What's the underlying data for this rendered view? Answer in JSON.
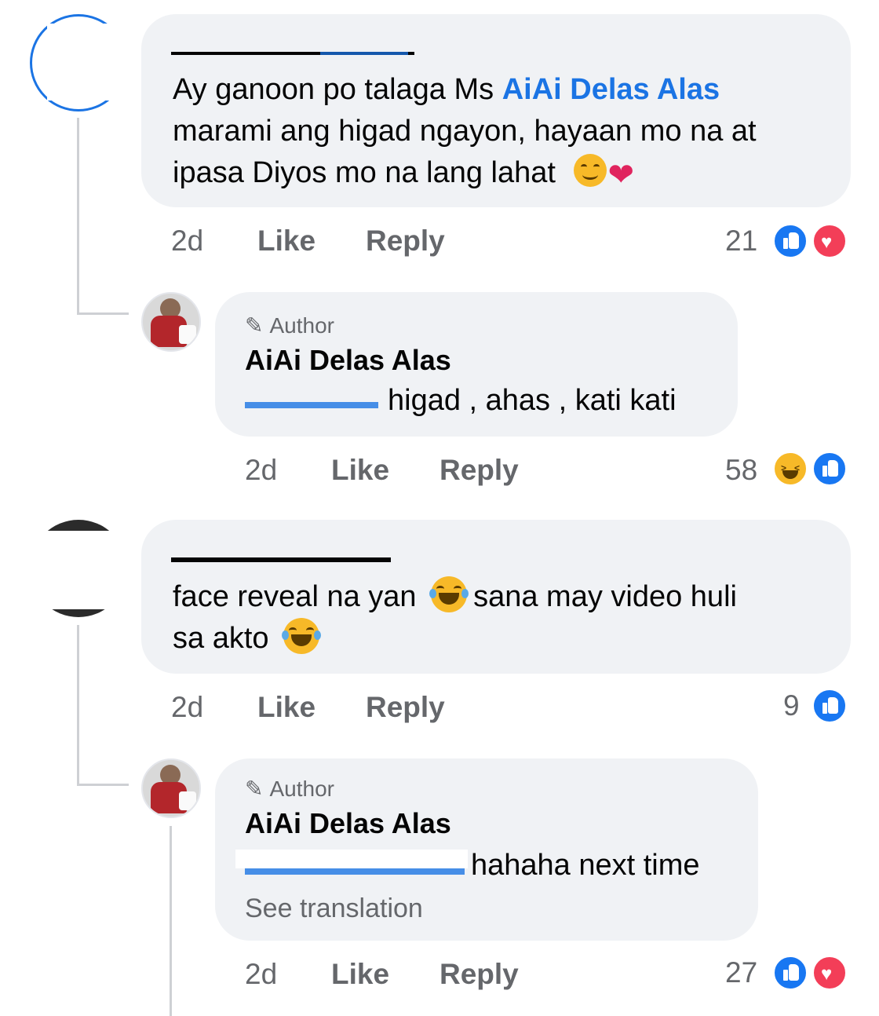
{
  "comments": [
    {
      "text_before": "Ay ganoon po talaga Ms ",
      "mention": "AiAi Delas Alas",
      "text_line2": "marami ang higad ngayon, hayaan mo na at",
      "text_line3": "ipasa Diyos mo na lang lahat",
      "time": "2d",
      "like": "Like",
      "reply": "Reply",
      "count": "21",
      "reactions": [
        "like-icon",
        "love-icon"
      ]
    },
    {
      "author_tag": "Author",
      "author_name": "AiAi Delas Alas",
      "text": "higad , ahas , kati kati",
      "time": "2d",
      "like": "Like",
      "reply": "Reply",
      "count": "58",
      "reactions": [
        "haha-icon",
        "like-icon"
      ]
    },
    {
      "text_line1": "face reveal na yan",
      "text_line1b": "sana may video huli",
      "text_line2": "sa akto",
      "time": "2d",
      "like": "Like",
      "reply": "Reply",
      "count": "9",
      "reactions": [
        "like-icon"
      ]
    },
    {
      "author_tag": "Author",
      "author_name": "AiAi Delas Alas",
      "text": "hahaha next time",
      "see_translation": "See translation",
      "time": "2d",
      "like": "Like",
      "reply": "Reply",
      "count": "27",
      "reactions": [
        "like-icon",
        "love-icon"
      ]
    }
  ],
  "colors": {
    "bubble": "#f0f2f5",
    "mention": "#1b74e4",
    "secondary_text": "#65676b",
    "like_blue": "#1877f2",
    "love_red": "#f33e58",
    "haha_yellow": "#f7b928"
  }
}
